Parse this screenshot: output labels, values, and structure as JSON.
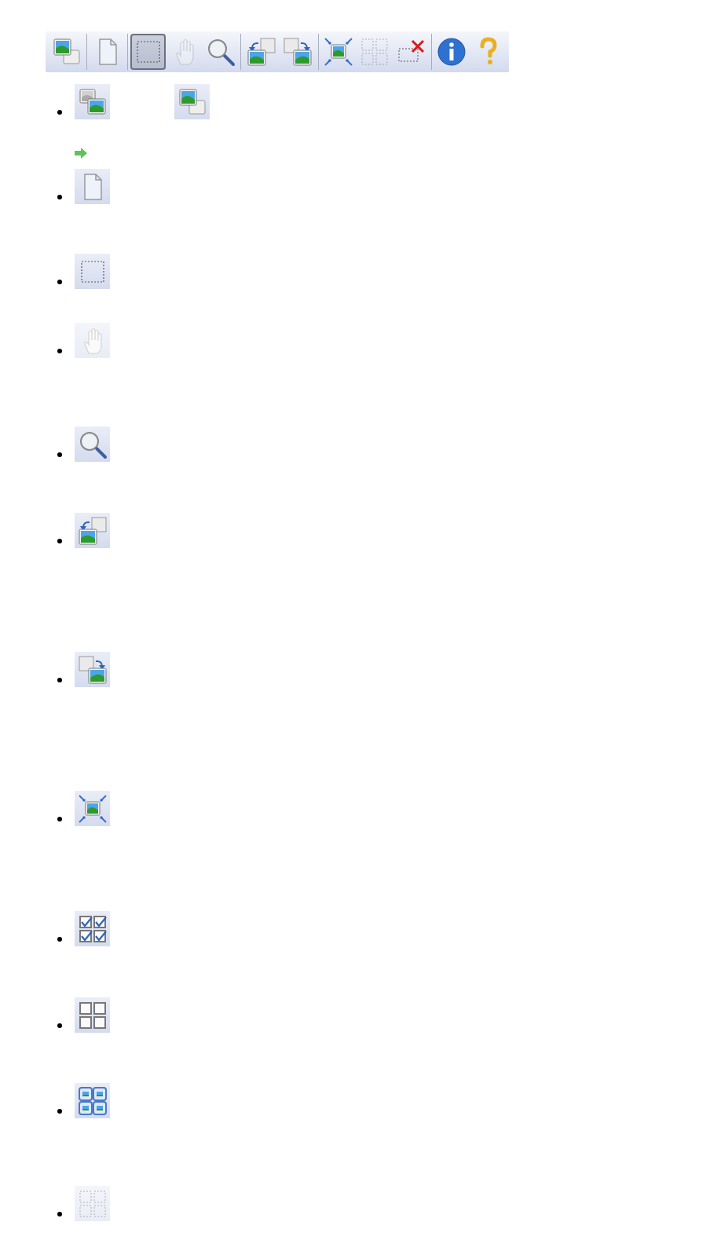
{
  "toolbar": {
    "items": [
      {
        "kind": "stack-front",
        "selected": false,
        "disabled": false
      },
      {
        "kind": "separator"
      },
      {
        "kind": "page",
        "selected": false,
        "disabled": false
      },
      {
        "kind": "separator"
      },
      {
        "kind": "crop",
        "selected": true,
        "disabled": false
      },
      {
        "kind": "hand",
        "selected": false,
        "disabled": true
      },
      {
        "kind": "zoom",
        "selected": false,
        "disabled": false
      },
      {
        "kind": "separator"
      },
      {
        "kind": "rotate-left",
        "selected": false,
        "disabled": false
      },
      {
        "kind": "rotate-right",
        "selected": false,
        "disabled": false
      },
      {
        "kind": "separator"
      },
      {
        "kind": "auto-crop",
        "selected": false,
        "disabled": false
      },
      {
        "kind": "multi-crop",
        "selected": false,
        "disabled": true
      },
      {
        "kind": "remove-crop",
        "selected": false,
        "disabled": false
      },
      {
        "kind": "separator"
      },
      {
        "kind": "info",
        "selected": false,
        "disabled": false
      },
      {
        "kind": "help",
        "selected": false,
        "disabled": false
      }
    ]
  },
  "list": [
    {
      "icons": [
        {
          "kind": "stack-back",
          "disabled": false
        },
        {
          "kind": "stack-front",
          "disabled": false
        }
      ],
      "arrow": true
    },
    {
      "icons": [
        {
          "kind": "page",
          "disabled": false
        }
      ]
    },
    {
      "icons": [
        {
          "kind": "crop",
          "disabled": false
        }
      ]
    },
    {
      "icons": [
        {
          "kind": "hand",
          "disabled": true
        }
      ]
    },
    {
      "icons": [
        {
          "kind": "zoom",
          "disabled": false
        }
      ]
    },
    {
      "icons": [
        {
          "kind": "rotate-left",
          "disabled": false
        }
      ]
    },
    {
      "icons": [
        {
          "kind": "rotate-right",
          "disabled": false
        }
      ]
    },
    {
      "icons": [
        {
          "kind": "auto-crop",
          "disabled": false
        }
      ]
    },
    {
      "icons": [
        {
          "kind": "check-all",
          "disabled": false
        }
      ]
    },
    {
      "icons": [
        {
          "kind": "uncheck-all",
          "disabled": false
        }
      ]
    },
    {
      "icons": [
        {
          "kind": "thumb-grid",
          "disabled": false
        }
      ]
    },
    {
      "icons": [
        {
          "kind": "multi-crop",
          "disabled": true
        }
      ]
    }
  ]
}
